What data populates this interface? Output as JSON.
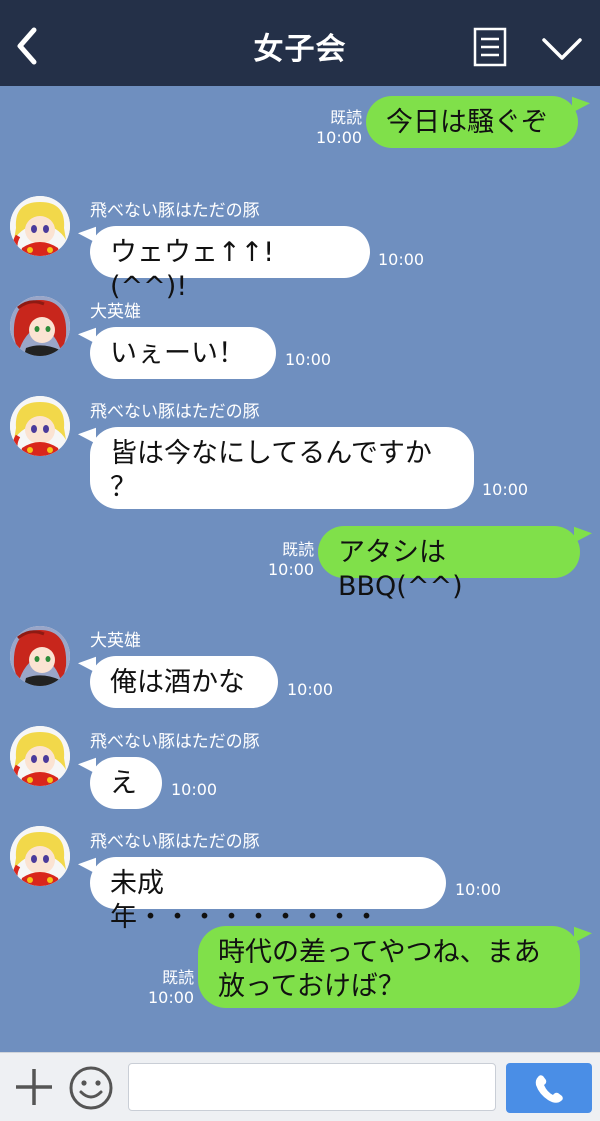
{
  "header": {
    "title": "女子会"
  },
  "icons": {
    "back": "chevron-left-icon",
    "menu": "menu-list-icon",
    "collapse": "chevron-down-icon",
    "plus": "plus-icon",
    "emoji": "smiley-icon",
    "call": "phone-icon"
  },
  "colors": {
    "header_bg": "#243048",
    "chat_bg": "#6f8fbf",
    "outgoing_bubble": "#80e04a",
    "incoming_bubble": "#ffffff",
    "call_button": "#4a8ee6"
  },
  "messages": [
    {
      "direction": "out",
      "text": "今日は騒ぐぞ",
      "read": "既読",
      "time": "10:00"
    },
    {
      "direction": "in",
      "sender": "飛べない豚はただの豚",
      "avatar": "blonde-girl-avatar",
      "text": "ウェウェ↑↑!(^^)!",
      "time": "10:00"
    },
    {
      "direction": "in",
      "sender": "大英雄",
      "avatar": "red-hair-avatar",
      "text": "いぇーい！",
      "time": "10:00"
    },
    {
      "direction": "in",
      "sender": "飛べない豚はただの豚",
      "avatar": "blonde-girl-avatar",
      "text": "皆は今なにしてるんですか\n？",
      "time": "10:00"
    },
    {
      "direction": "out",
      "text": "アタシはBBQ(^^)",
      "read": "既読",
      "time": "10:00"
    },
    {
      "direction": "in",
      "sender": "大英雄",
      "avatar": "red-hair-avatar",
      "text": "俺は酒かな",
      "time": "10:00"
    },
    {
      "direction": "in",
      "sender": "飛べない豚はただの豚",
      "avatar": "blonde-girl-avatar",
      "text": "え",
      "time": "10:00"
    },
    {
      "direction": "in",
      "sender": "飛べない豚はただの豚",
      "avatar": "blonde-girl-avatar",
      "text": "未成年・・・・・・・・・",
      "time": "10:00"
    },
    {
      "direction": "out",
      "text": "時代の差ってやつね、まあ\n放っておけば？",
      "read": "既読",
      "time": "10:00"
    }
  ],
  "composer": {
    "value": ""
  }
}
